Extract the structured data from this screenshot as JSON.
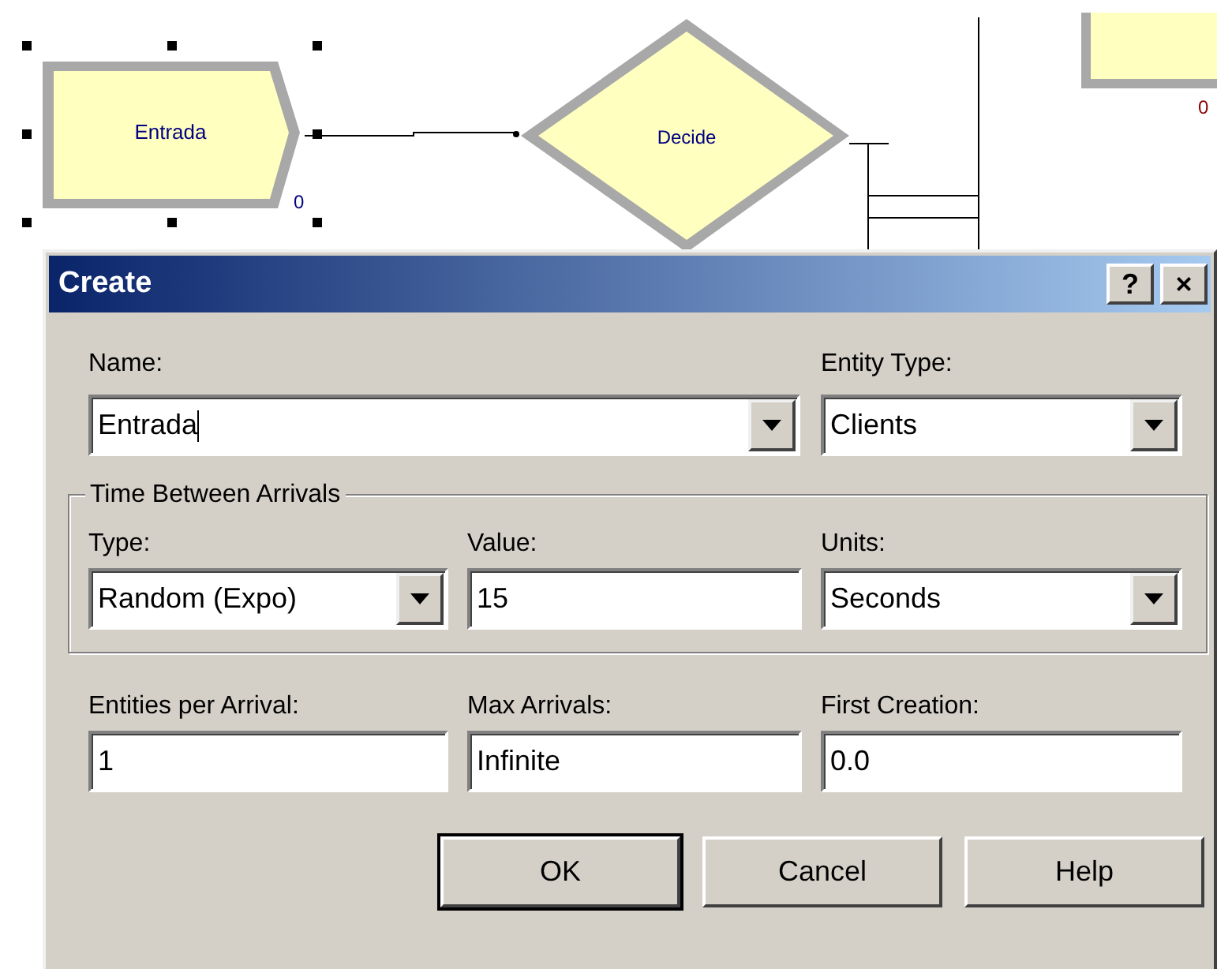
{
  "canvas": {
    "modules": [
      {
        "kind": "create",
        "label": "Entrada",
        "count": "0",
        "color": "#000080",
        "selected": true
      },
      {
        "kind": "decide",
        "label": "Decide"
      },
      {
        "kind": "process",
        "count": "0",
        "color": "#8b0000"
      }
    ]
  },
  "dialog": {
    "title": "Create",
    "title_buttons": [
      "?",
      "×"
    ],
    "name": {
      "label": "Name:",
      "value": "Entrada",
      "focused": true
    },
    "entity_type": {
      "label": "Entity Type:",
      "value": "Clients"
    },
    "group": {
      "title": "Time Between Arrivals",
      "fields": [
        {
          "label": "Type:",
          "value": "Random (Expo)",
          "kind": "dropdown"
        },
        {
          "label": "Value:",
          "value": "15",
          "kind": "text"
        },
        {
          "label": "Units:",
          "value": "Seconds",
          "kind": "dropdown"
        }
      ]
    },
    "fields": [
      {
        "label": "Entities per Arrival:",
        "value": "1",
        "kind": "text"
      },
      {
        "label": "Max Arrivals:",
        "value": "Infinite",
        "kind": "text"
      },
      {
        "label": "First Creation:",
        "value": "0.0",
        "kind": "text"
      }
    ],
    "buttons": [
      {
        "label": "OK",
        "default": true
      },
      {
        "label": "Cancel",
        "default": false
      },
      {
        "label": "Help",
        "default": false
      }
    ]
  }
}
